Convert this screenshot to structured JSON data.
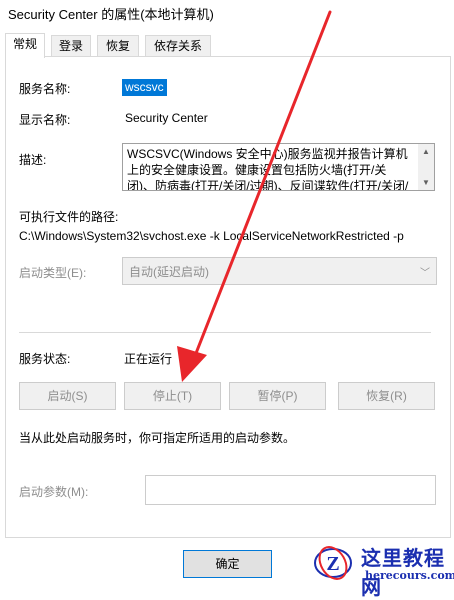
{
  "window": {
    "title": "Security Center 的属性(本地计算机)"
  },
  "tabs": [
    {
      "label": "常规",
      "active": true
    },
    {
      "label": "登录"
    },
    {
      "label": "恢复"
    },
    {
      "label": "依存关系"
    }
  ],
  "general": {
    "service_name_label": "服务名称:",
    "service_name_value": "wscsvc",
    "display_name_label": "显示名称:",
    "display_name_value": "Security Center",
    "description_label": "描述:",
    "description_value": "WSCSVC(Windows 安全中心)服务监视并报告计算机上的安全健康设置。健康设置包括防火墙(打开/关闭)、防病毒(打开/关闭/过期)、反间谍软件(打开/关闭/过",
    "exe_path_label": "可执行文件的路径:",
    "exe_path_value": "C:\\Windows\\System32\\svchost.exe -k LocalServiceNetworkRestricted -p",
    "startup_type_label": "启动类型(E):",
    "startup_type_value": "自动(延迟启动)",
    "status_label": "服务状态:",
    "status_value": "正在运行",
    "buttons": {
      "start": "启动(S)",
      "stop": "停止(T)",
      "pause": "暂停(P)",
      "resume": "恢复(R)"
    },
    "hint": "当从此处启动服务时，你可指定所适用的启动参数。",
    "start_params_label": "启动参数(M):",
    "start_params_value": ""
  },
  "footer": {
    "ok_label": "确定"
  },
  "watermark": {
    "title": "这里教程网",
    "url": "herecours.com"
  },
  "colors": {
    "selection": "#0078d7",
    "arrow": "#e8262b",
    "watermark": "#1b2fb0"
  }
}
